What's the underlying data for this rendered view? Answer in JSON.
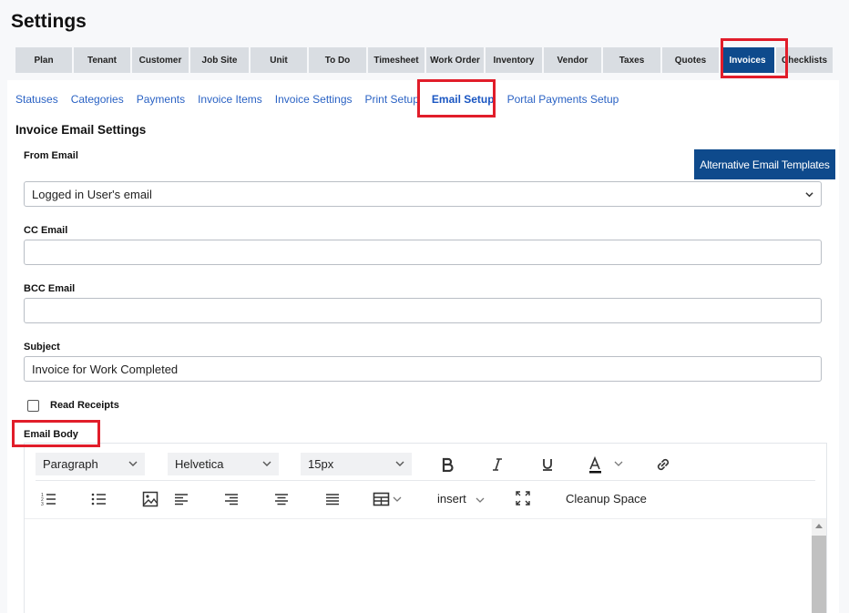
{
  "page": {
    "title": "Settings"
  },
  "main_tabs": [
    {
      "label": "Plan"
    },
    {
      "label": "Tenant"
    },
    {
      "label": "Customer"
    },
    {
      "label": "Job Site"
    },
    {
      "label": "Unit"
    },
    {
      "label": "To Do"
    },
    {
      "label": "Timesheet"
    },
    {
      "label": "Work Order"
    },
    {
      "label": "Inventory"
    },
    {
      "label": "Vendor"
    },
    {
      "label": "Taxes"
    },
    {
      "label": "Quotes"
    },
    {
      "label": "Invoices",
      "active": true
    },
    {
      "label": "Checklists"
    }
  ],
  "sub_tabs": [
    {
      "label": "Statuses"
    },
    {
      "label": "Categories"
    },
    {
      "label": "Payments"
    },
    {
      "label": "Invoice Items"
    },
    {
      "label": "Invoice Settings"
    },
    {
      "label": "Print Setup"
    },
    {
      "label": "Email Setup",
      "active": true
    },
    {
      "label": "Portal Payments Setup"
    }
  ],
  "form": {
    "section_title": "Invoice Email Settings",
    "alt_templates_button": "Alternative Email Templates",
    "from_email": {
      "label": "From Email",
      "value": "Logged in User's email"
    },
    "cc_email": {
      "label": "CC Email",
      "value": ""
    },
    "bcc_email": {
      "label": "BCC Email",
      "value": ""
    },
    "subject": {
      "label": "Subject",
      "value": "Invoice for Work Completed"
    },
    "read_receipts": {
      "label": "Read Receipts",
      "checked": false
    },
    "email_body": {
      "label": "Email Body"
    }
  },
  "editor": {
    "block_format": "Paragraph",
    "font_family": "Helvetica",
    "font_size": "15px",
    "insert_label": "insert",
    "cleanup_label": "Cleanup Space",
    "icons": {
      "bold": "bold-icon",
      "italic": "italic-icon",
      "underline": "underline-icon",
      "text_color": "text-color-icon",
      "link": "link-icon",
      "ordered_list": "ordered-list-icon",
      "unordered_list": "unordered-list-icon",
      "image": "image-icon",
      "align_left": "align-left-icon",
      "align_right": "align-right-icon",
      "align_center": "align-center-icon",
      "justify": "justify-icon",
      "table": "table-icon",
      "fullscreen": "fullscreen-icon"
    }
  },
  "colors": {
    "accent": "#0e4a8c",
    "link": "#2a62c4",
    "highlight": "#e11d2a",
    "tab_bg": "#d9dde2"
  }
}
